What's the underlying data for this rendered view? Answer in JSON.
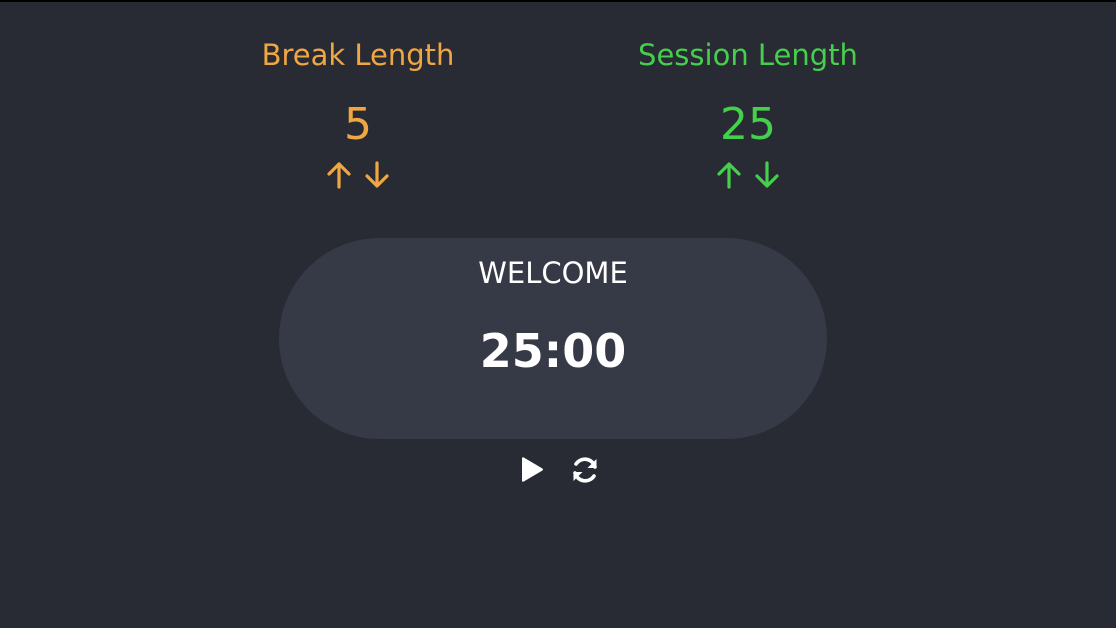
{
  "break": {
    "label": "Break Length",
    "value": "5",
    "color": "#f0a742",
    "increment_icon": "arrow-up-icon",
    "decrement_icon": "arrow-down-icon"
  },
  "session": {
    "label": "Session Length",
    "value": "25",
    "color": "#45cf4c",
    "increment_icon": "arrow-up-icon",
    "decrement_icon": "arrow-down-icon"
  },
  "timer": {
    "label": "WELCOME",
    "time": "25:00"
  },
  "controls": {
    "play_icon": "play-icon",
    "reset_icon": "refresh-icon"
  },
  "theme": {
    "background": "#282b33",
    "panel": "#363946",
    "text": "#ffffff"
  }
}
